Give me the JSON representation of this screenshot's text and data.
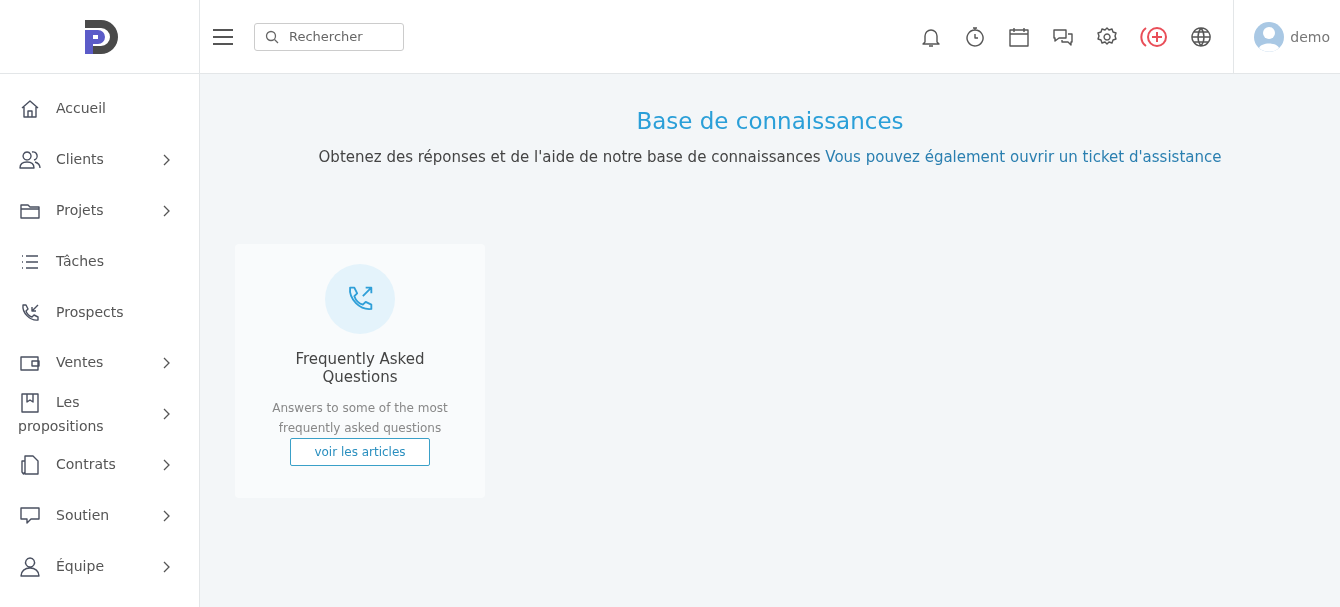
{
  "search": {
    "placeholder": "Rechercher"
  },
  "user": {
    "name": "demo"
  },
  "sidebar": {
    "items": [
      {
        "label": "Accueil",
        "expandable": false
      },
      {
        "label": "Clients",
        "expandable": true
      },
      {
        "label": "Projets",
        "expandable": true
      },
      {
        "label": "Tâches",
        "expandable": false
      },
      {
        "label": "Prospects",
        "expandable": false
      },
      {
        "label": "Ventes",
        "expandable": true
      },
      {
        "label": "Les propositions",
        "expandable": true
      },
      {
        "label": "Contrats",
        "expandable": true
      },
      {
        "label": "Soutien",
        "expandable": true
      },
      {
        "label": "Équipe",
        "expandable": true
      }
    ]
  },
  "page": {
    "title": "Base de connaissances",
    "intro": "Obtenez des réponses et de l'aide de notre base de connaissances",
    "link": "Vous pouvez également ouvrir un ticket d'assistance"
  },
  "cards": [
    {
      "title": "Frequently Asked Questions",
      "description": "Answers to some of the most frequently asked questions",
      "button": "voir les articles"
    }
  ]
}
